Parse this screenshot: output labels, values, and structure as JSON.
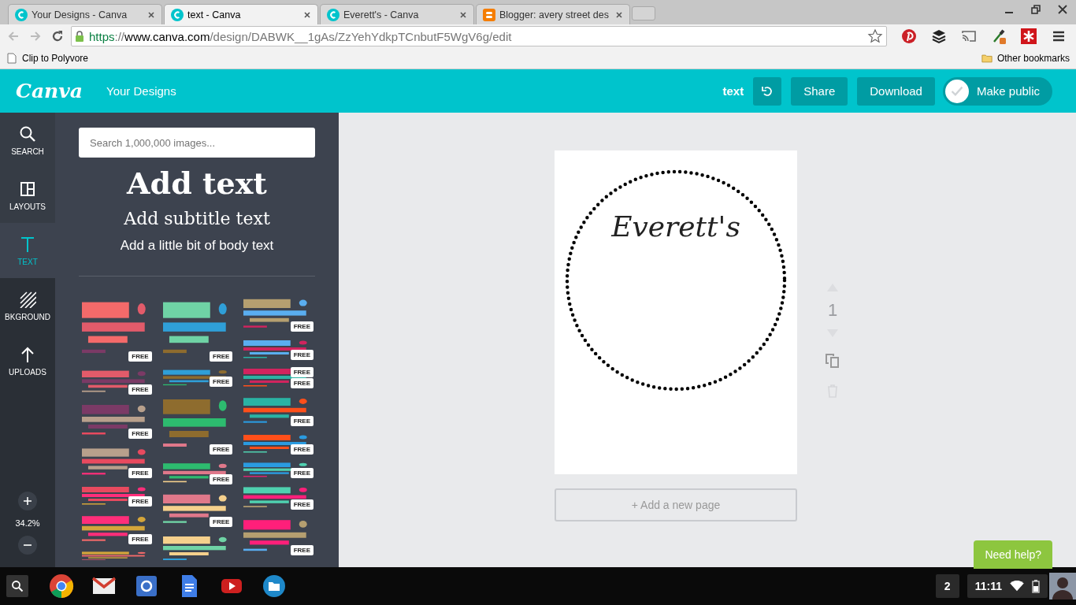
{
  "browser": {
    "tabs": [
      {
        "title": "Your Designs - Canva",
        "kind": "canva",
        "selected": false
      },
      {
        "title": "text - Canva",
        "kind": "canva",
        "selected": true
      },
      {
        "title": "Everett's - Canva",
        "kind": "canva",
        "selected": false
      },
      {
        "title": "Blogger: avery street des",
        "kind": "blogger",
        "selected": false
      }
    ],
    "url": {
      "scheme": "https",
      "separator": "://",
      "domain": "www.canva.com",
      "path": "/design/DABWK__1gAs/ZzYehYdkpTCnbutF5WgV6g/edit"
    },
    "bookmarks": [
      "Clip to Polyvore"
    ],
    "other_bookmarks": "Other bookmarks"
  },
  "header": {
    "logo": "Canva",
    "nav": "Your Designs",
    "design_name": "text",
    "buttons": [
      "Share",
      "Download"
    ],
    "make_public": {
      "label": "Make public",
      "on": false
    }
  },
  "rail": {
    "items": [
      {
        "label": "SEARCH",
        "kind": "search",
        "selected": false
      },
      {
        "label": "LAYOUTS",
        "kind": "layouts",
        "selected": false
      },
      {
        "label": "TEXT",
        "kind": "text",
        "selected": true
      },
      {
        "label": "BKGROUND",
        "kind": "background",
        "selected": false
      },
      {
        "label": "UPLOADS",
        "kind": "uploads",
        "selected": false
      }
    ],
    "zoom": "34.2%"
  },
  "panel": {
    "search": {
      "placeholder": "Search 1,000,000 images..."
    },
    "heading": "Add text",
    "subtitle": "Add subtitle text",
    "body": "Add a little bit of body text",
    "templates": [
      [
        {
          "kind": "picture",
          "badges": [
            "FREE"
          ]
        },
        {
          "kind": "picture",
          "badges": [
            "FREE"
          ]
        },
        {
          "kind": "picture",
          "badges": [
            "FREE"
          ]
        },
        {
          "kind": "picture",
          "badges": [
            "FREE"
          ]
        },
        {
          "kind": "picture",
          "badges": [
            "FREE"
          ]
        },
        {
          "kind": "picture",
          "badges": [
            "FREE"
          ]
        },
        {
          "kind": "picture"
        }
      ],
      [
        {
          "kind": "picture",
          "badges": [
            "FREE"
          ]
        },
        {
          "kind": "picture",
          "badges": [
            "FREE"
          ]
        },
        {
          "kind": "picture",
          "badges": [
            "FREE"
          ]
        },
        {
          "kind": "picture",
          "badges": [
            "FREE"
          ]
        },
        {
          "kind": "picture",
          "badges": [
            "FREE"
          ]
        },
        {
          "kind": "picture"
        }
      ],
      [
        {
          "kind": "picture",
          "badges": [
            "FREE"
          ]
        },
        {
          "kind": "picture",
          "badges": [
            "FREE"
          ]
        },
        {
          "kind": "picture",
          "badges": [
            "FREE",
            "FREE"
          ]
        },
        {
          "kind": "picture",
          "badges": [
            "FREE"
          ]
        },
        {
          "kind": "picture",
          "badges": [
            "FREE"
          ]
        },
        {
          "kind": "picture",
          "badges": [
            "FREE"
          ]
        },
        {
          "kind": "picture",
          "badges": [
            "FREE"
          ]
        },
        {
          "kind": "picture",
          "badges": [
            "FREE"
          ]
        }
      ]
    ]
  },
  "canvas": {
    "text": "Everett's",
    "page_number": "1",
    "add_page": "+ Add a new page"
  },
  "help": "Need help?",
  "taskbar": {
    "apps": [
      {
        "kind": "chrome"
      },
      {
        "kind": "mail"
      },
      {
        "kind": "search"
      },
      {
        "kind": "docs"
      },
      {
        "kind": "video"
      },
      {
        "kind": "files"
      }
    ],
    "notifications": "2",
    "time": "11:11"
  }
}
